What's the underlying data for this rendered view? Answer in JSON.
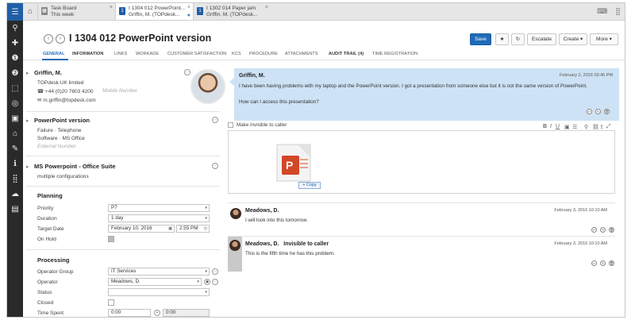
{
  "rail": {
    "icons": [
      "menu-icon",
      "search-icon",
      "new-call-icon",
      "incident-icon",
      "incident-icon",
      "change-icon",
      "problem-icon",
      "camera-icon",
      "asset-icon",
      "knowledge-icon",
      "info-icon",
      "apps-icon",
      "reservations-icon",
      "report-icon"
    ]
  },
  "tabs": [
    {
      "line1": "Task Board",
      "line2": "This week"
    },
    {
      "line1": "I 1304 012 PowerPoint...",
      "line2": "Griffin, M. (TOPdesk..."
    },
    {
      "line1": "I 1302 014 Paper jam",
      "line2": "Griffin, M. (TOPdesk..."
    }
  ],
  "header": {
    "title": "I 1304 012  PowerPoint version",
    "save": "Save",
    "escalate": "Escalate",
    "create": "Create",
    "more": "More"
  },
  "subnav": [
    "GENERAL",
    "INFORMATION",
    "LINKS",
    "WORKADE",
    "CUSTOMER SATISFACTION",
    "KCS",
    "PROCEDURE",
    "ATTACHMENTS",
    "AUDIT TRAIL (4)",
    "TIME REGISTRATION"
  ],
  "caller": {
    "name": "Griffin, M.",
    "company": "TOPdesk UK limited",
    "phone": "+44 (0)20 7803 4200",
    "mobile_placeholder": "Mobile Number",
    "email": "m.griffin@topdesk.com"
  },
  "object": {
    "title": "PowerPoint version",
    "type_label": "Failure",
    "type_value": "Telephone",
    "cat_label": "Software",
    "cat_value": "MS Office",
    "external_placeholder": "External Number"
  },
  "asset": {
    "title": "MS Powerpoint  - Office Suite",
    "subtitle": "multiple configurations"
  },
  "planning": {
    "heading": "Planning",
    "priority_label": "Priority",
    "priority_value": "P7",
    "duration_label": "Duration",
    "duration_value": "1 day",
    "target_label": "Target Date",
    "target_date": "February 10, 2016",
    "target_time": "2:55 PM",
    "onhold_label": "On Hold"
  },
  "processing": {
    "heading": "Processing",
    "group_label": "Operator Group",
    "group_value": "IT Services",
    "operator_label": "Operator",
    "operator_value": "Meadows, D.",
    "status_label": "Status",
    "status_value": "",
    "closed_label": "Closed",
    "time_label": "Time Spent",
    "time_value": "0:00",
    "time_value2": "0:00"
  },
  "messages": {
    "first": {
      "author": "Griffin, M.",
      "date": "February 2, 2016 03:45 PM",
      "line1": "I have been having problems with my laptop and the PowerPoint version. I got a presentation from someone else but it is not the same version of PowerPoint.",
      "line2": "How can I access this presentation?"
    },
    "invisible_label": "Make invisible to caller",
    "copy_tip": "Copy",
    "second": {
      "author": "Meadows, D.",
      "date": "February 3, 2016 10:10 AM",
      "text": "I will look into this tomorrow."
    },
    "third": {
      "author": "Meadows, D.",
      "tag": "Invisible to caller",
      "date": "February 3, 2016 10:10 AM",
      "text": "This is the fifth time he has this problem."
    }
  },
  "colors": {
    "accent": "#1f6bb8",
    "rail": "#2a2a2a",
    "bubble": "#cde2f4"
  }
}
